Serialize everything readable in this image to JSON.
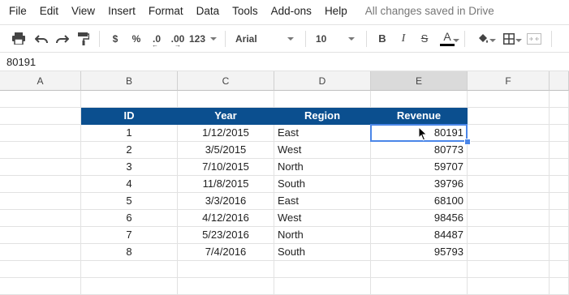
{
  "menu": {
    "items": [
      "File",
      "Edit",
      "View",
      "Insert",
      "Format",
      "Data",
      "Tools",
      "Add-ons",
      "Help"
    ],
    "save_status": "All changes saved in Drive"
  },
  "toolbar": {
    "currency_label": "$",
    "percent_label": "%",
    "decrease_decimals_label": ".0",
    "increase_decimals_label": ".00",
    "more_formats_label": "123",
    "font": "Arial",
    "font_size": "10",
    "bold_label": "B",
    "italic_label": "I",
    "strikethrough_label": "S",
    "text_color_label": "A"
  },
  "formula_bar": {
    "value": "80191"
  },
  "columns": [
    "A",
    "B",
    "C",
    "D",
    "E",
    "F"
  ],
  "selected_column": "E",
  "table": {
    "headers": [
      "ID",
      "Year",
      "Region",
      "Revenue"
    ],
    "rows": [
      [
        "1",
        "1/12/2015",
        "East",
        "80191"
      ],
      [
        "2",
        "3/5/2015",
        "West",
        "80773"
      ],
      [
        "3",
        "7/10/2015",
        "North",
        "59707"
      ],
      [
        "4",
        "11/8/2015",
        "South",
        "39796"
      ],
      [
        "5",
        "3/3/2016",
        "East",
        "68100"
      ],
      [
        "6",
        "4/12/2016",
        "West",
        "98456"
      ],
      [
        "7",
        "5/23/2016",
        "North",
        "84487"
      ],
      [
        "8",
        "7/4/2016",
        "South",
        "95793"
      ]
    ]
  },
  "colors": {
    "header_fill": "#0b4f8f",
    "selection": "#4a86e8"
  }
}
